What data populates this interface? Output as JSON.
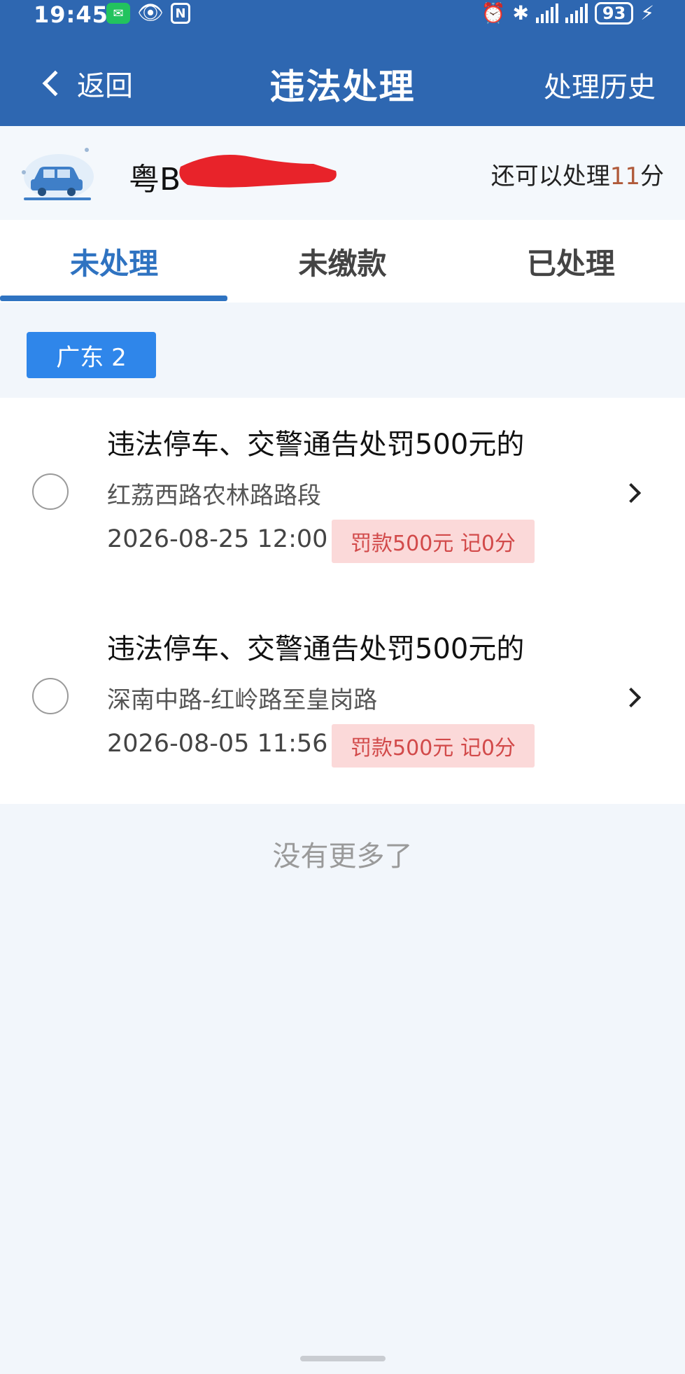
{
  "status_bar": {
    "time": "19:45",
    "battery": "93"
  },
  "nav": {
    "back_label": "返回",
    "title": "违法处理",
    "history_label": "处理历史"
  },
  "vehicle": {
    "plate_prefix": "粤B",
    "points_prefix": "还可以处理",
    "points_value": "11",
    "points_suffix": "分"
  },
  "tabs": [
    {
      "label": "未处理",
      "active": true
    },
    {
      "label": "未缴款",
      "active": false
    },
    {
      "label": "已处理",
      "active": false
    }
  ],
  "region_chip": "广东 2",
  "violations": [
    {
      "title": "违法停车、交警通告处罚500元的",
      "location": "红荔西路农林路路段",
      "datetime": "2026-08-25 12:00",
      "penalty": "罚款500元 记0分"
    },
    {
      "title": "违法停车、交警通告处罚500元的",
      "location": "深南中路-红岭路至皇岗路",
      "datetime": "2026-08-05 11:56",
      "penalty": "罚款500元 记0分"
    }
  ],
  "footer": {
    "no_more": "没有更多了"
  },
  "colors": {
    "header_bg": "#2e67b1",
    "accent_blue": "#2f73c1",
    "chip_blue": "#2f86ea",
    "penalty_bg": "#fbd9d9",
    "penalty_text": "#d24a4a",
    "points_num": "#b05a3a"
  }
}
